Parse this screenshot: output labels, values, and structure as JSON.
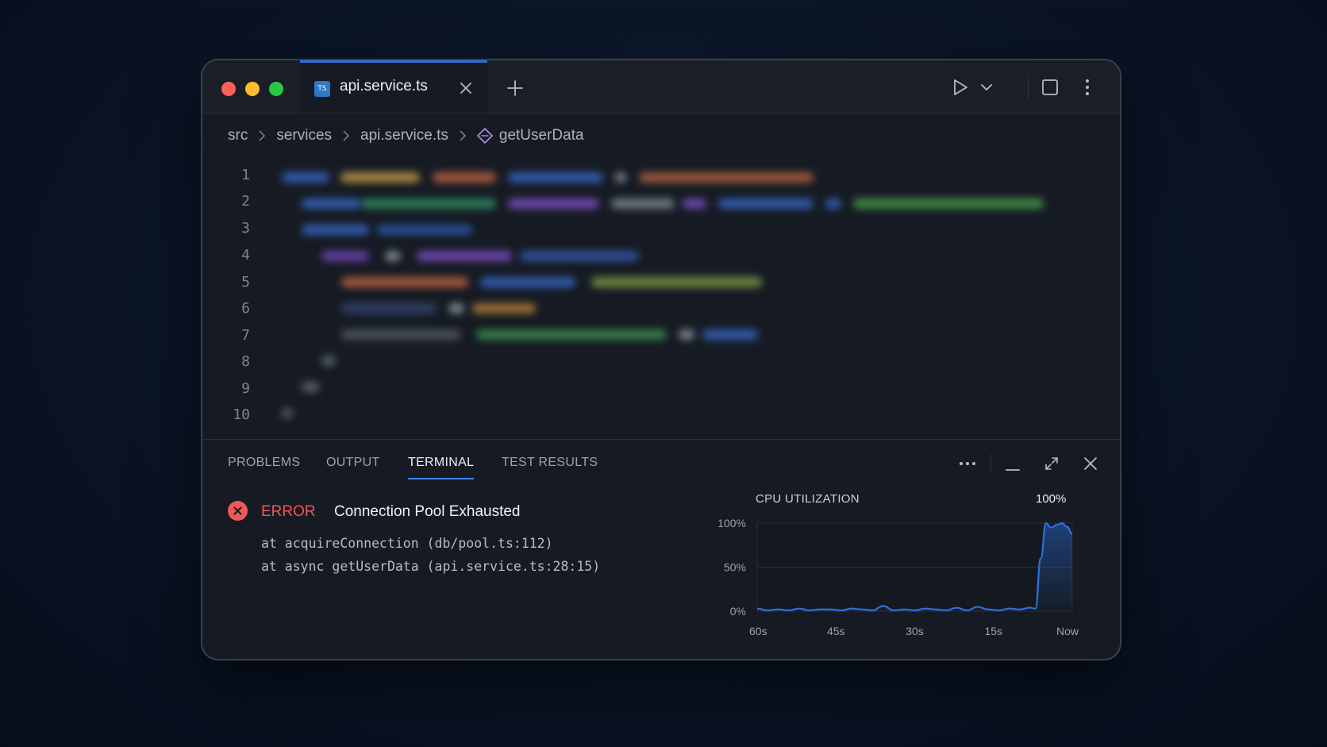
{
  "window": {
    "tab": {
      "badge": "TS",
      "filename": "api.service.ts"
    }
  },
  "breadcrumb": [
    "src",
    "services",
    "api.service.ts",
    "getUserData"
  ],
  "editor": {
    "line_numbers": [
      "1",
      "2",
      "3",
      "4",
      "5",
      "6",
      "7",
      "8",
      "9",
      "10"
    ]
  },
  "panel": {
    "tabs": [
      "PROBLEMS",
      "OUTPUT",
      "TERMINAL",
      "TEST RESULTS"
    ],
    "active_tab": "TERMINAL",
    "error": {
      "level": "ERROR",
      "message": "Connection Pool Exhausted",
      "trace": [
        "at acquireConnection (db/pool.ts:112)",
        "at async getUserData (api.service.ts:28:15)"
      ]
    },
    "colors": {
      "error": "#f0575a",
      "accent": "#3b82f6"
    }
  },
  "chart_data": {
    "type": "area",
    "title": "CPU UTILIZATION",
    "current_value_label": "100%",
    "x_tick_labels": [
      "60s",
      "45s",
      "30s",
      "15s",
      "Now"
    ],
    "y_tick_labels": [
      "100%",
      "50%",
      "0%"
    ],
    "ylim": [
      0,
      100
    ],
    "xlim": [
      -60,
      0
    ],
    "x": [
      -60,
      -58,
      -56,
      -54,
      -52,
      -50,
      -48,
      -46,
      -44,
      -42,
      -40,
      -38,
      -36,
      -34,
      -32,
      -30,
      -28,
      -26,
      -24,
      -22,
      -20,
      -18,
      -16,
      -14,
      -12,
      -10,
      -8,
      -7,
      -6,
      -5,
      -4,
      -3,
      -2,
      -1,
      0
    ],
    "values": [
      3,
      1,
      2,
      1,
      3,
      1,
      2,
      2,
      1,
      3,
      2,
      1,
      6,
      1,
      2,
      1,
      3,
      2,
      1,
      4,
      1,
      5,
      2,
      1,
      3,
      2,
      4,
      3,
      60,
      100,
      95,
      98,
      100,
      96,
      88
    ],
    "series_color": "#2f6fe0",
    "grid": true
  }
}
